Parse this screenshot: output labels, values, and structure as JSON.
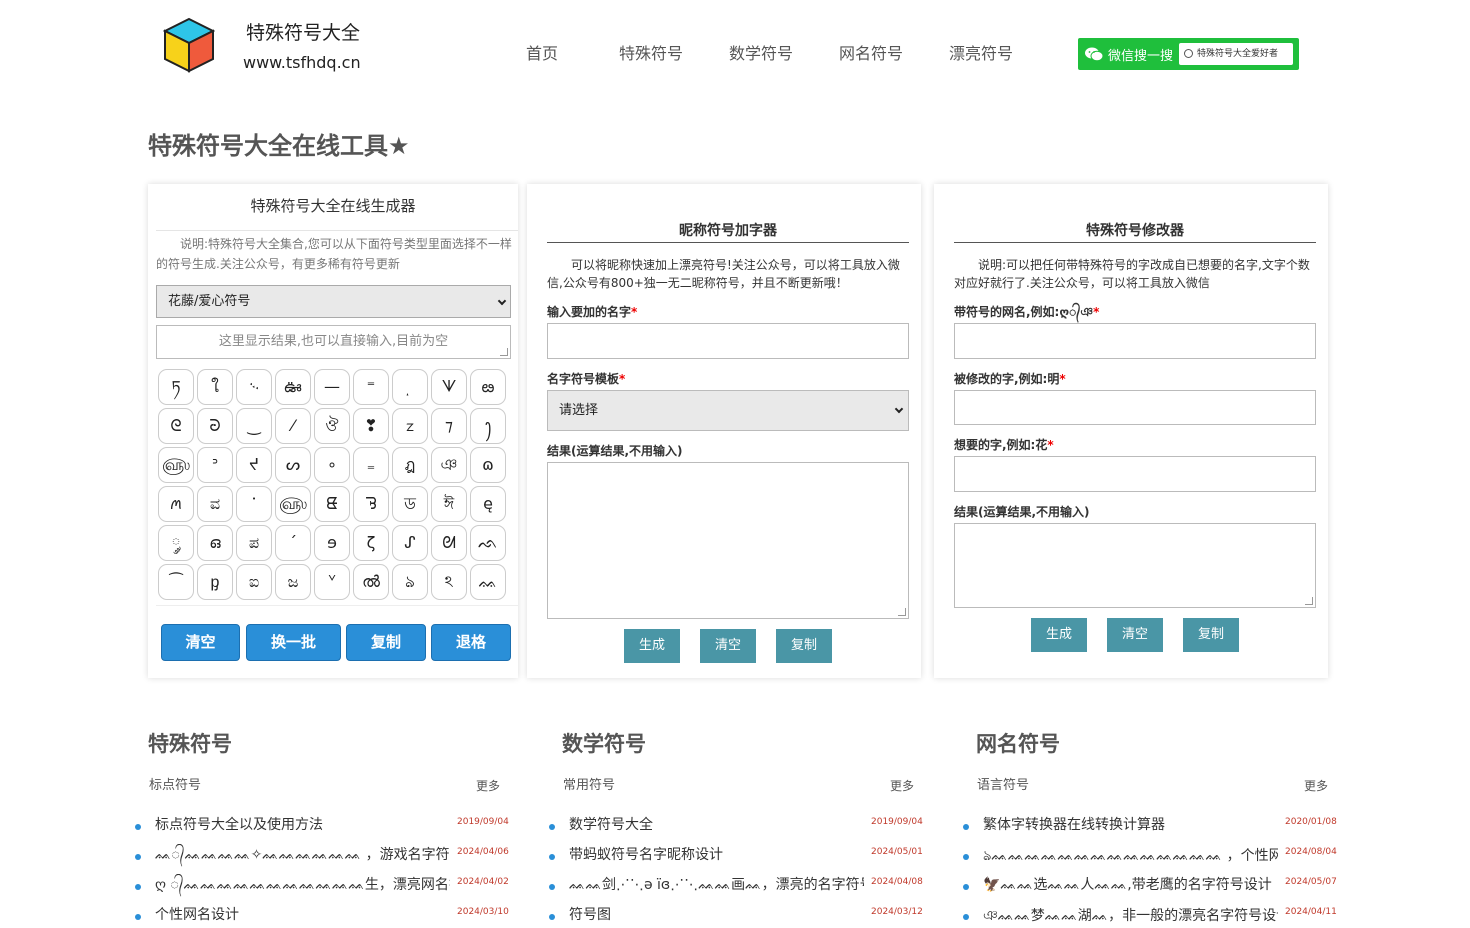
{
  "header": {
    "site_name": "特殊符号大全",
    "site_url": "www.tsfhdq.cn",
    "nav": [
      "首页",
      "特殊符号",
      "数学符号",
      "网名符号",
      "漂亮符号"
    ],
    "wechat_label": "微信搜一搜",
    "wechat_search_text": "特殊符号大全爱好者"
  },
  "page_title": "特殊符号大全在线工具★",
  "generator": {
    "title": "特殊符号大全在线生成器",
    "desc": "说明:特殊符号大全集合,您可以从下面符号类型里面选择不一样的符号生成.关注公众号，有更多稀有符号更新",
    "select_value": "花藤/爱心符号",
    "result_placeholder": "这里显示结果,也可以直接输入,目前为空",
    "symbols": [
      "ཏ",
      "ใ",
      "࿙",
      "ఊ",
      "—",
      "⁼",
      "𝅾",
      "ᗐ",
      "ఴ",
      "ᘓ",
      "ᘒ",
      "‿",
      "⁄",
      "ঔ",
      "❣",
      "ᤁ",
      "⁊",
      "ꫂ",
      "௵",
      "ᐣ",
      "ᔪ",
      "ᔕ",
      "∘",
      "₌",
      "ฎ",
      "ঞ",
      "ɷ",
      "ꪔ",
      "ವ",
      "ᱸ",
      "௵",
      "ᘀ",
      "ᘋ",
      "ড",
      "ঈ",
      "ę",
      "༘",
      "ഒ",
      "ಪ",
      "ˊ",
      "ɘ",
      "ζ",
      "ᔑ",
      "ᘛ",
      "ᨒ",
      "⁀",
      "ᶈ",
      "ಐ",
      "ಜ",
      "ᘁ",
      "ൽ",
      "ঌ",
      "ঽ",
      "ᨐ"
    ],
    "buttons": [
      "清空",
      "换一批",
      "复制",
      "退格"
    ]
  },
  "nick": {
    "title": "昵称符号加字器",
    "desc": "可以将昵称快速加上漂亮符号!关注公众号，可以将工具放入微信,公众号有800+独一无二昵称符号，并且不断更新哦！",
    "label_name": "输入要加的名字",
    "label_template": "名字符号模板",
    "template_value": "请选择",
    "label_result": "结果(运算结果,不用输入)",
    "buttons": [
      "生成",
      "清空",
      "复制"
    ],
    "req": "*"
  },
  "modifier": {
    "title": "特殊符号修改器",
    "desc": "说明:可以把任何带特殊符号的字改成自已想要的名字,文字个数对应好就行了.关注公众号，可以将工具放入微信",
    "label_sym": "带符号的网名,例如:ღ᭄ঞ",
    "label_from": "被修改的字,例如:明",
    "label_to": "想要的字,例如:花",
    "label_result": "结果(运算结果,不用输入)",
    "buttons": [
      "生成",
      "清空",
      "复制"
    ],
    "req": "*"
  },
  "sections": [
    {
      "title": "特殊符号",
      "sub": "标点符号",
      "more": "更多",
      "items": [
        {
          "t": "标点符号大全以及使用方法",
          "d": "2019/09/04"
        },
        {
          "t": "ᨐ᭄ᨐᨐᨐᨐ✧ᨐᨐᨐᨐᨐᨐ ，游戏名字符号",
          "d": "2024/04/06"
        },
        {
          "t": "ღ ᭄ᨐᨐᨐᨐᨐᨐᨐᨐᨐᨐᨐ生，漂亮网名符号设计",
          "d": "2024/04/02"
        },
        {
          "t": "个性网名设计",
          "d": "2024/03/10"
        }
      ]
    },
    {
      "title": "数学符号",
      "sub": "常用符号",
      "more": "更多",
      "items": [
        {
          "t": "数学符号大全",
          "d": "2019/09/04"
        },
        {
          "t": "带蚂蚁符号名字昵称设计",
          "d": "2024/05/01"
        },
        {
          "t": "ᨐᨐ剑⋰⋱ə ïɞ⋰⋱ᨐᨐ画ᨐ，漂亮的名字符号",
          "d": "2024/04/08"
        },
        {
          "t": "符号图",
          "d": "2024/03/12"
        }
      ]
    },
    {
      "title": "网名符号",
      "sub": "语言符号",
      "more": "更多",
      "items": [
        {
          "t": "繁体字转换器在线转换计算器",
          "d": "2020/01/08"
        },
        {
          "t": "ঌᨐᨐᨐᨐᨐᨐᨐᨐᨐᨐᨐᨐᨐᨐ ，个性网名符号设计",
          "d": "2024/08/04"
        },
        {
          "t": "🦅ᨐᨐ选ᨐᨐ人ᨐᨐ,带老鹰的名字符号设计",
          "d": "2024/05/07"
        },
        {
          "t": "ঞᨐᨐ梦ᨐᨐ湖ᨐ，非一般的漂亮名字符号设计",
          "d": "2024/04/11"
        }
      ]
    }
  ],
  "colors": {
    "accent_blue": "#2a8fd8",
    "button_teal": "#4a96a6",
    "wechat_green": "#1fbf3c",
    "date_red": "#c0392b"
  }
}
